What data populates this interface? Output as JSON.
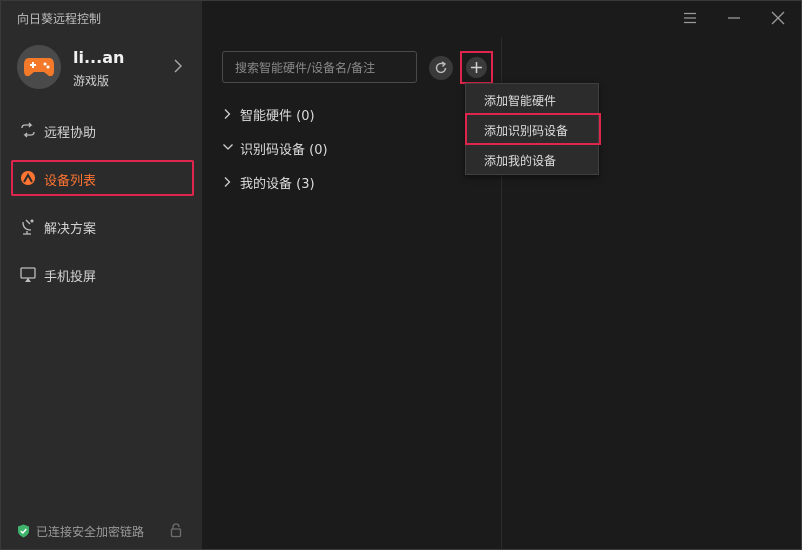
{
  "app": {
    "title": "向日葵远程控制"
  },
  "profile": {
    "name": "li...an",
    "tier": "游戏版"
  },
  "nav": {
    "items": [
      {
        "label": "远程协助",
        "icon": "remote-assist-icon"
      },
      {
        "label": "设备列表",
        "icon": "device-list-icon",
        "active": true
      },
      {
        "label": "解决方案",
        "icon": "solution-icon"
      },
      {
        "label": "手机投屏",
        "icon": "screen-cast-icon"
      }
    ]
  },
  "status": {
    "text": "已连接安全加密链路"
  },
  "search": {
    "placeholder": "搜索智能硬件/设备名/备注"
  },
  "groups": [
    {
      "label": "智能硬件 (0)",
      "expanded": false
    },
    {
      "label": "识别码设备 (0)",
      "expanded": true
    },
    {
      "label": "我的设备 (3)",
      "expanded": false
    }
  ],
  "add_menu": {
    "items": [
      {
        "label": "添加智能硬件"
      },
      {
        "label": "添加识别码设备",
        "highlighted": true
      },
      {
        "label": "添加我的设备"
      }
    ]
  },
  "colors": {
    "accent": "#ff7433",
    "highlight_border": "#e0254c",
    "sidebar_bg": "#2b2b2b",
    "main_bg": "#1b1b1b"
  }
}
